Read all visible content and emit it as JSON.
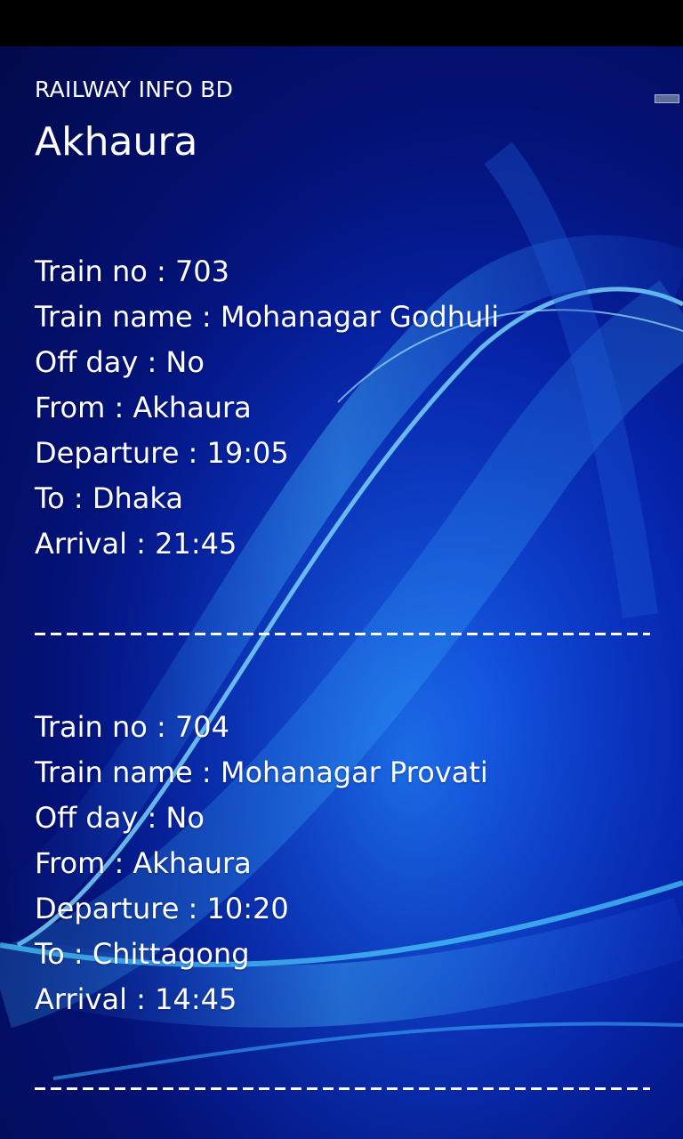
{
  "app": {
    "title": "RAILWAY INFO BD",
    "station": "Akhaura"
  },
  "trains": [
    {
      "train_no": "Train no : 703",
      "train_name": "Train name : Mohanagar Godhuli",
      "off_day": "Off day : No",
      "from": "From : Akhaura",
      "departure": "Departure : 19:05",
      "to": "To : Dhaka",
      "arrival": "Arrival :  21:45"
    },
    {
      "train_no": "Train no : 704",
      "train_name": "Train name : Mohanagar Provati",
      "off_day": "Off day : No",
      "from": "From : Akhaura",
      "departure": "Departure : 10:20",
      "to": "To : Chittagong",
      "arrival": "Arrival :  14:45"
    }
  ],
  "theme": {
    "background_dark": "#020a4a",
    "background_mid": "#0522a8",
    "wave_highlight": "#4fc8ff",
    "text": "#ffffff"
  }
}
